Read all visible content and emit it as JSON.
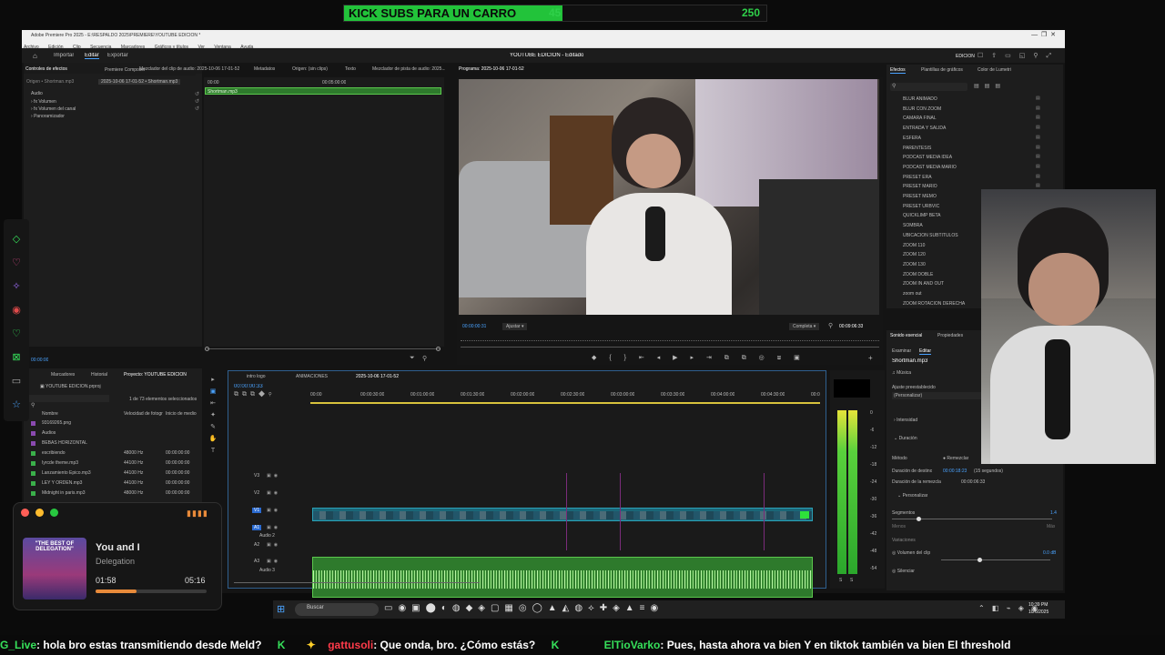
{
  "banner": {
    "label": "KICK SUBS PARA UN CARRO",
    "current": "45",
    "goal": "250"
  },
  "window": {
    "title": "Adobe Premiere Pro 2025 - E:\\RESPALDO 2025\\PREMIERE\\YOUTUBE EDICION *",
    "menus": [
      "Archivo",
      "Edición",
      "Clip",
      "Secuencia",
      "Marcadores",
      "Gráficos y títulos",
      "Ver",
      "Ventana",
      "Ayuda"
    ],
    "nav": [
      "Importar",
      "Editar",
      "Exportar"
    ],
    "project_title": "YOUTUBE EDICION - Editado",
    "workspace": "EDICIÓN"
  },
  "source_panel": {
    "tabs": [
      "Controles de efectos",
      "Premiere Composer",
      "Mezclador del clip de audio: 2025-10-06 17-01-52",
      "Metadatos",
      "Origen: (sin clips)",
      "Texto",
      "Mezclador de pista de audio: 2025..."
    ],
    "source_label": "Origen • Shortman.mp3",
    "seq_label": "2025-10-06 17-01-52 • Shortman.mp3",
    "section": "Audio",
    "effects": [
      "Volumen",
      "Volumen del canal",
      "Panoramizador"
    ],
    "ruler_start": "00:00",
    "ruler_mid": "00:05:00:00",
    "clip": "Shortman.mp3",
    "time": "00:00:00"
  },
  "program": {
    "title": "Programa: 2025-10-06 17-01-52",
    "timecode": "00:00:00:31",
    "fit": "Ajustar",
    "quality": "Completa",
    "duration": "00:09:06:33"
  },
  "effects_panel": {
    "tabs": [
      "Efectos",
      "Plantillas de gráficos",
      "Color de Lumetri"
    ],
    "presets": [
      "BLUR ANIMADO",
      "BLUR CON ZOOM",
      "CAMARA FINAL",
      "ENTRADA Y SALIDA",
      "ESFERA",
      "PARENTESIS",
      "PODCAST MEDIA IDEA",
      "PODCAST MEDIA MARIO",
      "PRESET ERA",
      "PRESET MARIO",
      "PRESET MEMO",
      "PRESET URBVIC",
      "QUICKLIMP BETA",
      "SOMBRA",
      "UBICACION SUBTITULOS",
      "ZOOM 110",
      "ZOOM 120",
      "ZOOM 130",
      "ZOOM DOBLE",
      "ZOOM IN AND OUT",
      "zoom out",
      "ZOOM ROTACION DERECHA"
    ]
  },
  "essential_sound": {
    "tabs": [
      "Sonido esencial",
      "Propiedades"
    ],
    "sub": [
      "Examinar",
      "Editar"
    ],
    "clip": "Shortman.mp3",
    "type": "Música",
    "preset_label": "Ajuste preestablecido",
    "preset": "(Personalizar)",
    "sections": [
      "Intensidad",
      "Duración"
    ],
    "method_label": "Método",
    "method": "Remezclar",
    "target_label": "Duración de destino",
    "target": "00:00:18:23",
    "target_secs": "(15 segundos)",
    "remix_label": "Duración de la remezcla",
    "remix": "00:00:06:33",
    "customize": "Personalizar",
    "segments": "Segmentos",
    "segments_val": "1.4",
    "less": "Menos",
    "more": "Más",
    "variations": "Variaciones",
    "clip_volume": "Volumen del clip",
    "clip_volume_val": "0.0 dB",
    "silence": "Silenciar"
  },
  "project_panel": {
    "tabs": [
      "Marcadores",
      "Historial",
      "Proyecto: YOUTUBE EDICION"
    ],
    "file": "YOUTUBE EDICION.prproj",
    "count": "1 de 73 elementos seleccionados",
    "cols": [
      "Nombre",
      "Velocidad de fotogr",
      "Inicio de medio"
    ],
    "rows": [
      {
        "name": "93169265.png",
        "fps": "",
        "start": ""
      },
      {
        "name": "Audios",
        "fps": "",
        "start": ""
      },
      {
        "name": "BEBAS HORIZONTAL",
        "fps": "",
        "start": ""
      },
      {
        "name": "escribiendo",
        "fps": "48000 Hz",
        "start": "00:00:00:00"
      },
      {
        "name": "Iyrcde theme.mp3",
        "fps": "44100 Hz",
        "start": "00:00:00:00"
      },
      {
        "name": "Lanzamiento Épico.mp3",
        "fps": "44100 Hz",
        "start": "00:00:00:00"
      },
      {
        "name": "LEY Y ORDEN.mp3",
        "fps": "44100 Hz",
        "start": "00:00:00:00"
      },
      {
        "name": "Midnight in paris.mp3",
        "fps": "48000 Hz",
        "start": "00:00:00:00"
      }
    ]
  },
  "timeline": {
    "tabs": [
      "intro logo",
      "ANIMACIONES",
      "2025-10-06 17-01-52"
    ],
    "timecode": "00:00:00:33",
    "ruler": [
      "00:00",
      "00:00:30:00",
      "00:01:00:00",
      "00:01:30:00",
      "00:02:00:00",
      "00:02:30:00",
      "00:03:00:00",
      "00:03:30:00",
      "00:04:00:00",
      "00:04:30:00",
      "00:0"
    ],
    "tracks": [
      "V3",
      "V2",
      "V1",
      "A1",
      "A2",
      "A3"
    ],
    "audio_names": [
      "Audio 2",
      "Audio 3"
    ],
    "meter_scale": [
      "0",
      "-6",
      "-12",
      "-18",
      "-24",
      "-30",
      "-36",
      "-42",
      "-48",
      "-54"
    ],
    "meter_bottom": [
      "S",
      "S"
    ]
  },
  "player": {
    "title": "You and I",
    "artist": "Delegation",
    "elapsed": "01:58",
    "total": "05:16",
    "album_text": "\"THE BEST OF DELEGATION\"",
    "progress": 0.37
  },
  "taskbar": {
    "search": "Buscar",
    "time": "10:39 PM",
    "date": "10/6/2025"
  },
  "chat": [
    {
      "user": "G_Live",
      "msg": "hola bro estas transmitiendo desde Meld?",
      "color": "#36e05a"
    },
    {
      "user": "gattusoli",
      "msg": "Que onda, bro. ¿Cómo estás?",
      "color": "#ff3b4a"
    },
    {
      "user": "ElTioVarko",
      "msg": "Pues, hasta ahora va bien Y en tiktok también va bien El threshold",
      "color": "#36e05a"
    }
  ]
}
